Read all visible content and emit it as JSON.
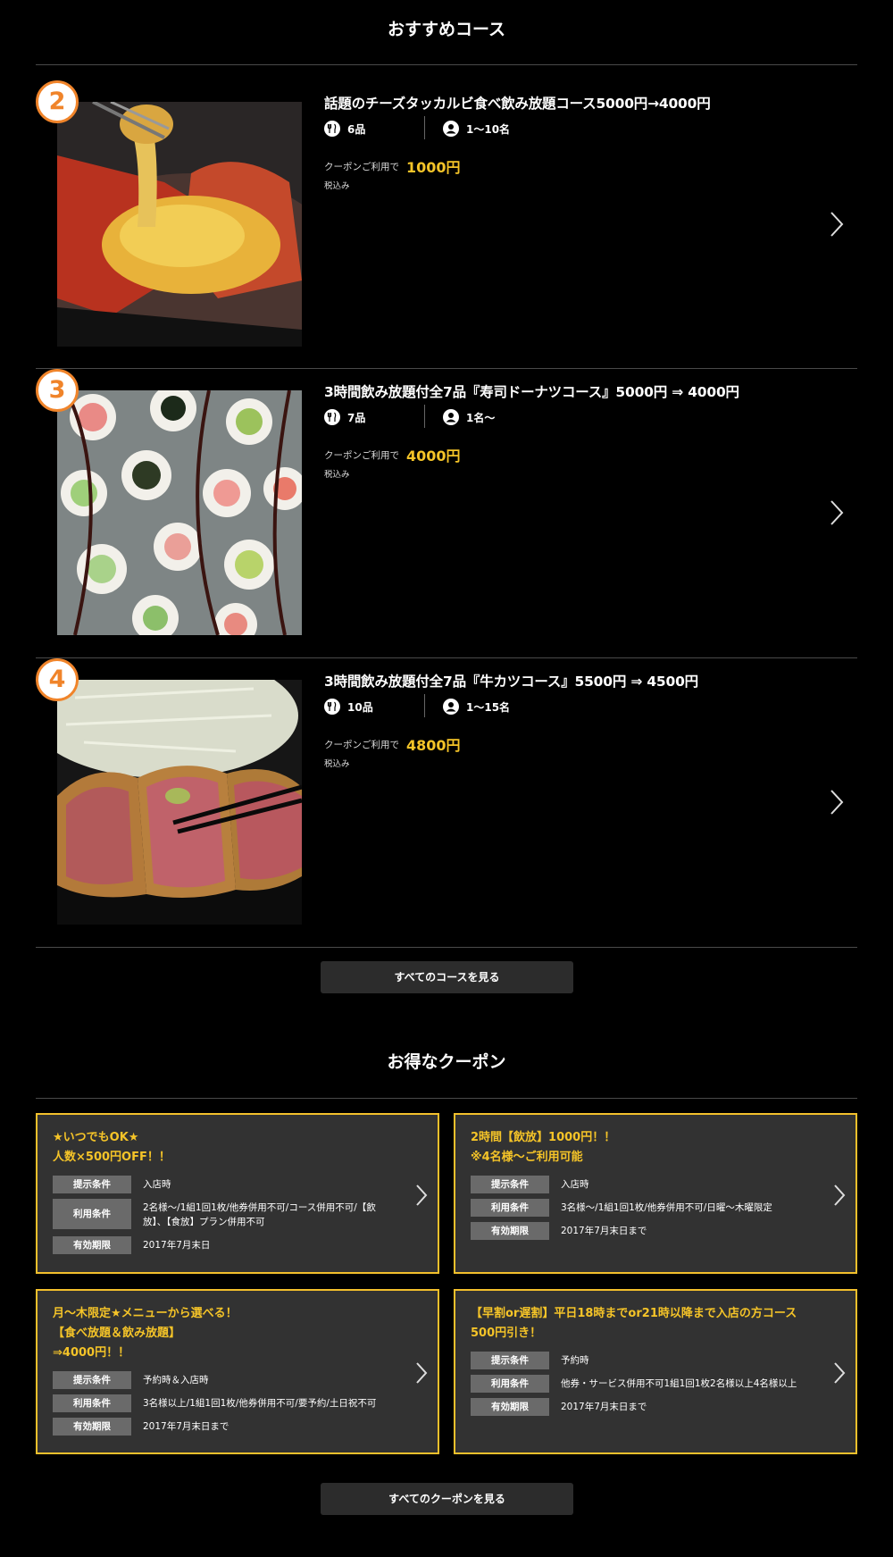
{
  "courses_section": {
    "title": "おすすめコース",
    "items": [
      {
        "rank": "2",
        "name": "話題のチーズタッカルビ食べ飲み放題コース5000円→4000円",
        "dishes": "6品",
        "people": "1〜10名",
        "coupon_label": "クーポンご利用で",
        "price": "1000円",
        "tax": "税込み",
        "photo_icon": "cheese-dakgalbi-photo"
      },
      {
        "rank": "3",
        "name": "3時間飲み放題付全7品『寿司ドーナツコース』5000円 ⇒ 4000円",
        "dishes": "7品",
        "people": "1名〜",
        "coupon_label": "クーポンご利用で",
        "price": "4000円",
        "tax": "税込み",
        "photo_icon": "sushi-donut-photo"
      },
      {
        "rank": "4",
        "name": "3時間飲み放題付全7品『牛カツコース』5500円 ⇒ 4500円",
        "dishes": "10品",
        "people": "1〜15名",
        "coupon_label": "クーポンご利用で",
        "price": "4800円",
        "tax": "税込み",
        "photo_icon": "gyukatsu-photo"
      }
    ],
    "all_button": "すべてのコースを見る"
  },
  "coupons_section": {
    "title": "お得なクーポン",
    "items": [
      {
        "title_lines": [
          "★いつでもOK★",
          "人数×500円OFF！！"
        ],
        "rows": [
          {
            "label": "提示条件",
            "value": "入店時"
          },
          {
            "label": "利用条件",
            "value": "2名様〜/1組1回1枚/他券併用不可/コース併用不可/【飲放】、【食放】プラン併用不可"
          },
          {
            "label": "有効期限",
            "value": "2017年7月末日"
          }
        ]
      },
      {
        "title_lines": [
          "2時間【飲放】1000円！！",
          "※4名様〜ご利用可能"
        ],
        "rows": [
          {
            "label": "提示条件",
            "value": "入店時"
          },
          {
            "label": "利用条件",
            "value": "3名様〜/1組1回1枚/他券併用不可/日曜〜木曜限定"
          },
          {
            "label": "有効期限",
            "value": "2017年7月末日まで"
          }
        ]
      },
      {
        "title_lines": [
          "月〜木限定★メニューから選べる！",
          "【食べ放題＆飲み放題】",
          "⇒4000円！！"
        ],
        "rows": [
          {
            "label": "提示条件",
            "value": "予約時＆入店時"
          },
          {
            "label": "利用条件",
            "value": "3名様以上/1組1回1枚/他券併用不可/要予約/土日祝不可"
          },
          {
            "label": "有効期限",
            "value": "2017年7月末日まで"
          }
        ]
      },
      {
        "title_lines": [
          "【早割or遅割】平日18時までor21時以降まで入店の方コース",
          "500円引き！"
        ],
        "rows": [
          {
            "label": "提示条件",
            "value": "予約時"
          },
          {
            "label": "利用条件",
            "value": "他券・サービス併用不可1組1回1枚2名様以上4名様以上"
          },
          {
            "label": "有効期限",
            "value": "2017年7月末日まで"
          }
        ]
      }
    ],
    "all_button": "すべてのクーポンを見る"
  },
  "colors": {
    "accent": "#f5c428",
    "rank": "#f0842a",
    "panel": "#323232"
  }
}
